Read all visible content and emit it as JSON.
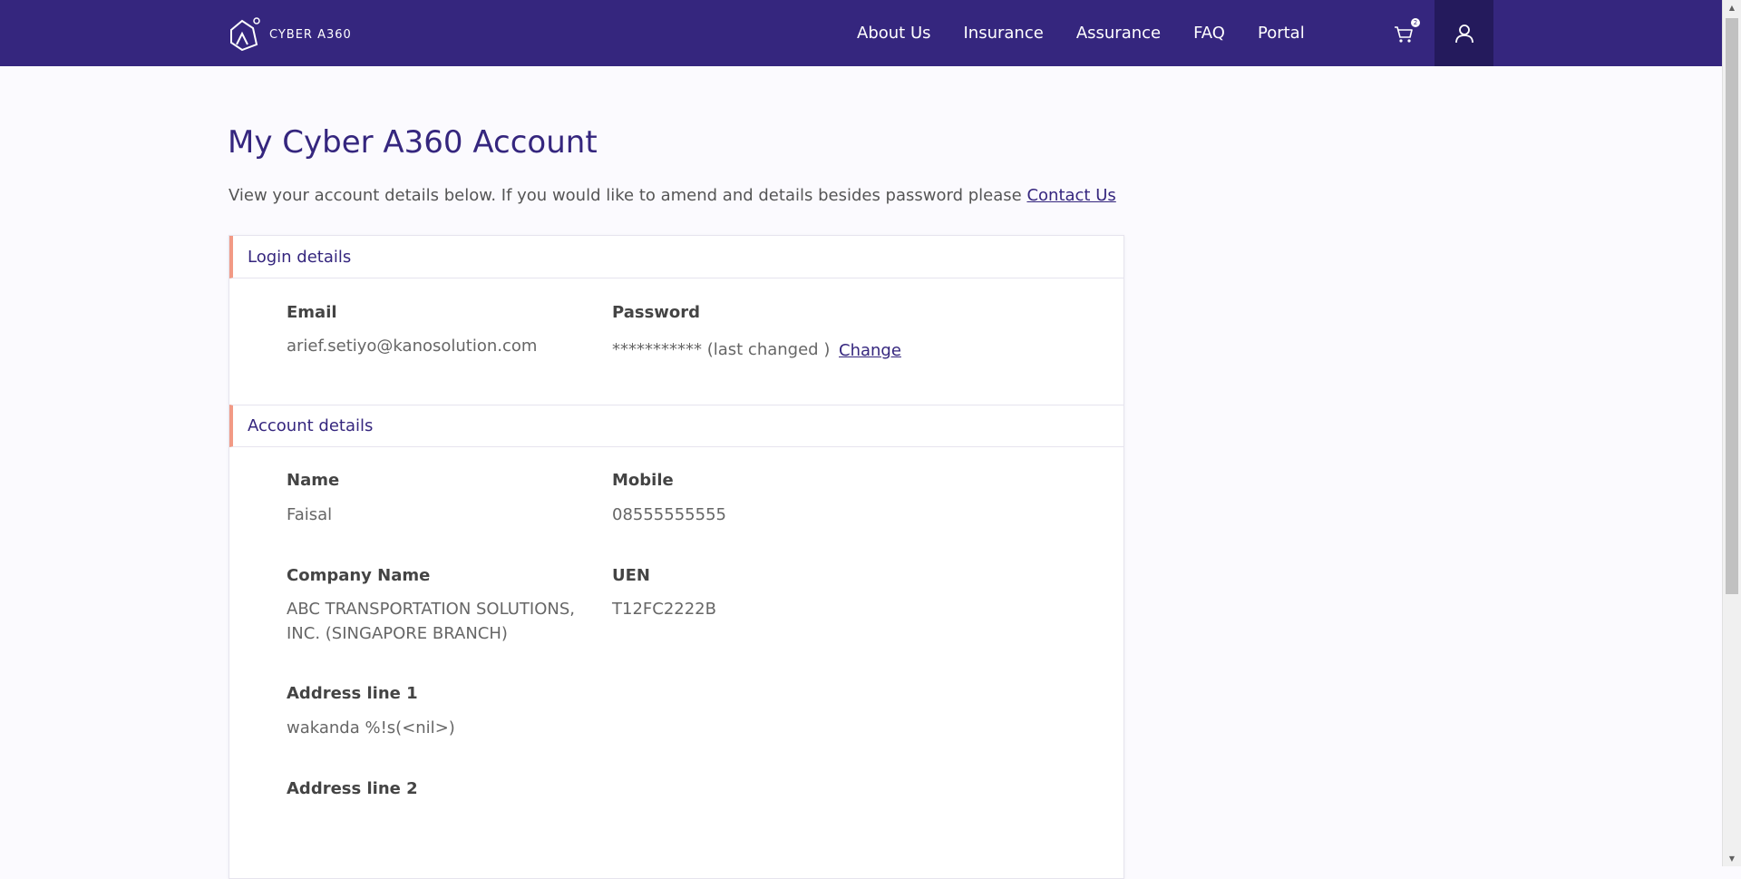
{
  "header": {
    "logo_text": "CYBER A360",
    "nav": [
      {
        "label": "About Us"
      },
      {
        "label": "Insurance"
      },
      {
        "label": "Assurance"
      },
      {
        "label": "FAQ"
      },
      {
        "label": "Portal"
      }
    ],
    "cart_icon": "cart-icon",
    "cart_count": "2",
    "user_icon": "user-icon"
  },
  "main": {
    "title": "My Cyber A360 Account",
    "intro_text": "View your account details below. If you would like to amend and details besides password please",
    "contact_link": "Contact Us"
  },
  "login_details": {
    "heading": "Login details",
    "email_label": "Email",
    "email_value": "arief.setiyo@kanosolution.com",
    "password_label": "Password",
    "password_value": "*********** (last changed )",
    "change_label": "Change"
  },
  "account_details": {
    "heading": "Account details",
    "name_label": "Name",
    "name_value": "Faisal",
    "mobile_label": "Mobile",
    "mobile_value": "08555555555",
    "company_label": "Company Name",
    "company_value_line1": "ABC TRANSPORTATION SOLUTIONS,",
    "company_value_line2": "INC. (SINGAPORE BRANCH)",
    "uen_label": "UEN",
    "uen_value": "T12FC2222B",
    "address1_label": "Address line 1",
    "address1_value": "wakanda %!s(<nil>)",
    "address2_label": "Address line 2",
    "address2_value": ""
  },
  "colors": {
    "header_bg": "#35267e",
    "accent_bar": "#f29a85",
    "title": "#35267e"
  }
}
